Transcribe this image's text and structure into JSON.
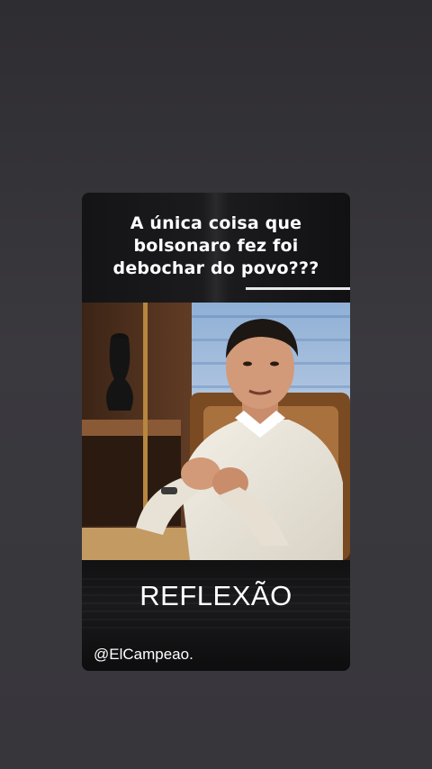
{
  "post": {
    "caption_lines": [
      "A única coisa que",
      "bolsonaro fez foi",
      "debochar do povo???"
    ],
    "title": "REFLEXÃO",
    "handle": "@ElCampeao."
  },
  "colors": {
    "page_background": "#37363b",
    "card_background": "#0c0c0d",
    "text": "#ffffff"
  }
}
